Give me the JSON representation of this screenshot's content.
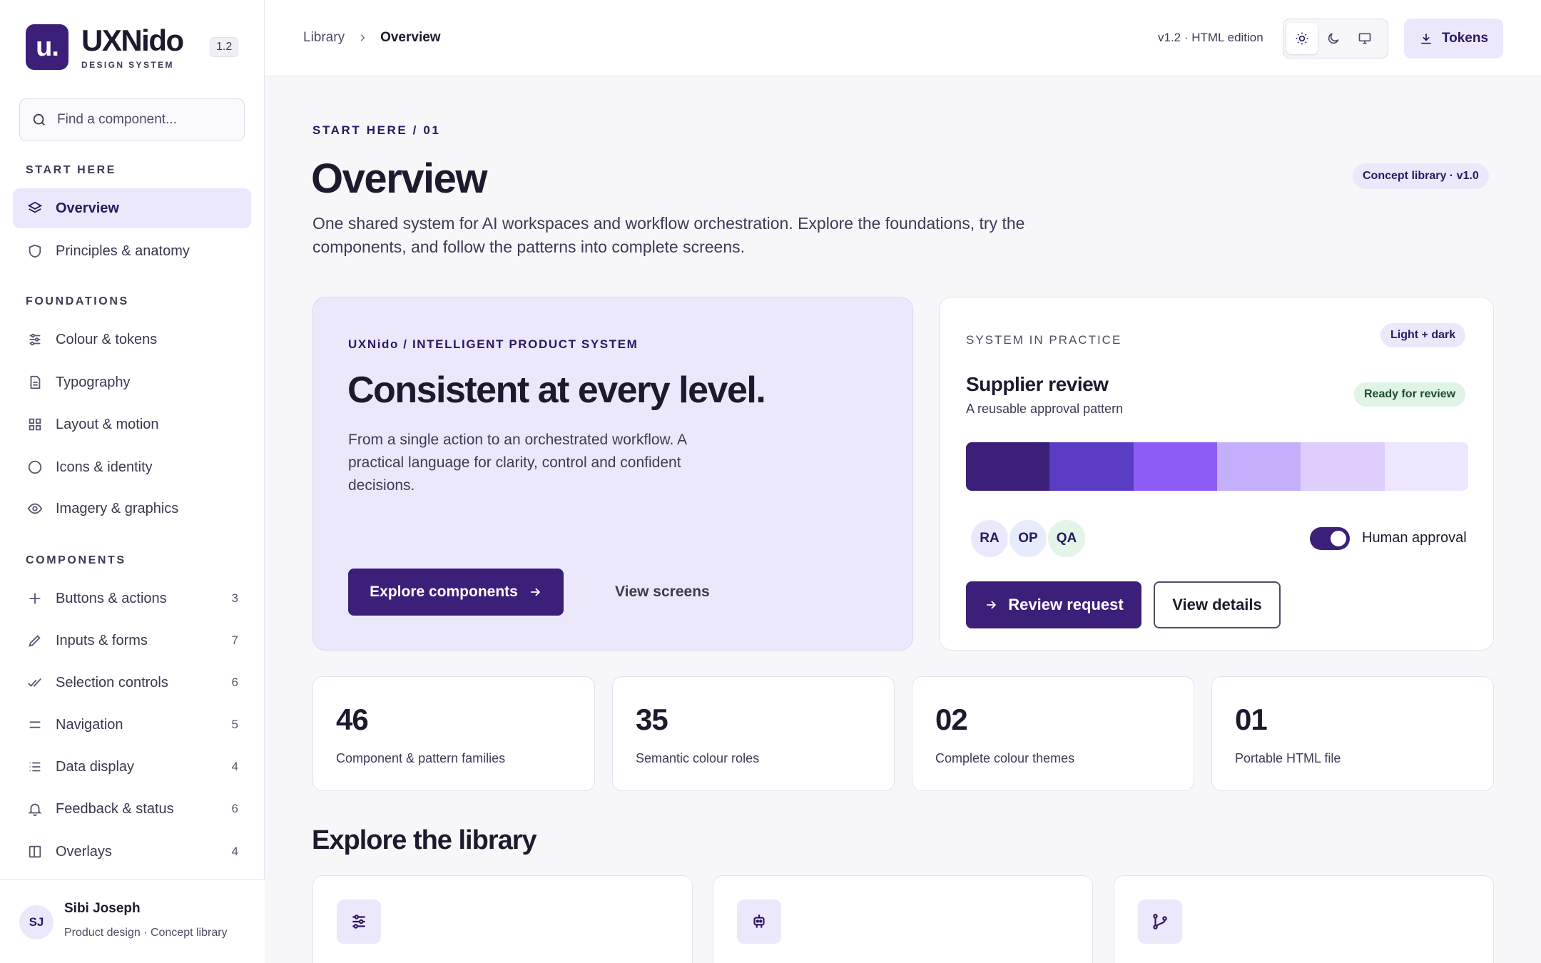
{
  "brand": {
    "logo_text": "u.",
    "name": "UXNido",
    "subtitle": "DESIGN SYSTEM",
    "version": "1.2"
  },
  "search": {
    "placeholder": "Find a component..."
  },
  "sidebar": {
    "sections": [
      {
        "title": "START HERE",
        "items": [
          {
            "label": "Overview",
            "icon": "layers-icon",
            "active": true
          },
          {
            "label": "Principles & anatomy",
            "icon": "shield-icon"
          }
        ]
      },
      {
        "title": "FOUNDATIONS",
        "items": [
          {
            "label": "Colour & tokens",
            "icon": "sliders-icon"
          },
          {
            "label": "Typography",
            "icon": "document-icon"
          },
          {
            "label": "Layout & motion",
            "icon": "grid-icon"
          },
          {
            "label": "Icons & identity",
            "icon": "circle-icon"
          },
          {
            "label": "Imagery & graphics",
            "icon": "eye-icon"
          }
        ]
      },
      {
        "title": "COMPONENTS",
        "items": [
          {
            "label": "Buttons & actions",
            "icon": "plus-icon",
            "count": "3"
          },
          {
            "label": "Inputs & forms",
            "icon": "pencil-icon",
            "count": "7"
          },
          {
            "label": "Selection controls",
            "icon": "check-double-icon",
            "count": "6"
          },
          {
            "label": "Navigation",
            "icon": "menu-icon",
            "count": "5"
          },
          {
            "label": "Data display",
            "icon": "list-icon",
            "count": "4"
          },
          {
            "label": "Feedback & status",
            "icon": "bell-icon",
            "count": "6"
          },
          {
            "label": "Overlays",
            "icon": "panel-icon",
            "count": "4"
          }
        ]
      }
    ]
  },
  "user": {
    "initials": "SJ",
    "name": "Sibi Joseph",
    "role": "Product design · Concept library"
  },
  "topbar": {
    "breadcrumb": {
      "library": "Library",
      "current": "Overview"
    },
    "edition": "v1.2 · HTML edition",
    "theme_options": [
      "sun-icon",
      "moon-icon",
      "monitor-icon"
    ],
    "tokens_label": "Tokens"
  },
  "page": {
    "eyebrow": "START HERE / 01",
    "title": "Overview",
    "badge": "Concept library · v1.0",
    "intro": "One shared system for AI workspaces and workflow orchestration. Explore the foundations, try the components, and follow the patterns into complete screens."
  },
  "hero": {
    "eyebrow": "UXNido / INTELLIGENT PRODUCT SYSTEM",
    "title": "Consistent at every level.",
    "description": "From a single action to an orchestrated workflow. A practical language for clarity, control and confident decisions.",
    "primary_label": "Explore components",
    "secondary_label": "View screens"
  },
  "practice": {
    "eyebrow": "SYSTEM IN PRACTICE",
    "theme_chip": "Light + dark",
    "title": "Supplier review",
    "subtitle": "A reusable approval pattern",
    "status_chip": "Ready for review",
    "swatches": [
      "#3b1f78",
      "#5b3cc4",
      "#8d5cf6",
      "#c4b0fa",
      "#dccdfb",
      "#ede6fd"
    ],
    "avatars": [
      {
        "initials": "RA",
        "color": "#ece8fc"
      },
      {
        "initials": "OP",
        "color": "#e6ecfb"
      },
      {
        "initials": "QA",
        "color": "#e2f5e8"
      }
    ],
    "toggle_label": "Human approval",
    "toggle_on": true,
    "review_label": "Review request",
    "details_label": "View details"
  },
  "stats": [
    {
      "value": "46",
      "label": "Component & pattern families"
    },
    {
      "value": "35",
      "label": "Semantic colour roles"
    },
    {
      "value": "02",
      "label": "Complete colour themes"
    },
    {
      "value": "01",
      "label": "Portable HTML file"
    }
  ],
  "library": {
    "title": "Explore the library",
    "cards": [
      {
        "icon": "sliders-icon"
      },
      {
        "icon": "robot-icon"
      },
      {
        "icon": "git-branch-icon"
      }
    ]
  },
  "colors": {
    "accent": "#3b1f78",
    "accent_soft": "#ece8fc",
    "success_soft": "#dff4e4"
  }
}
